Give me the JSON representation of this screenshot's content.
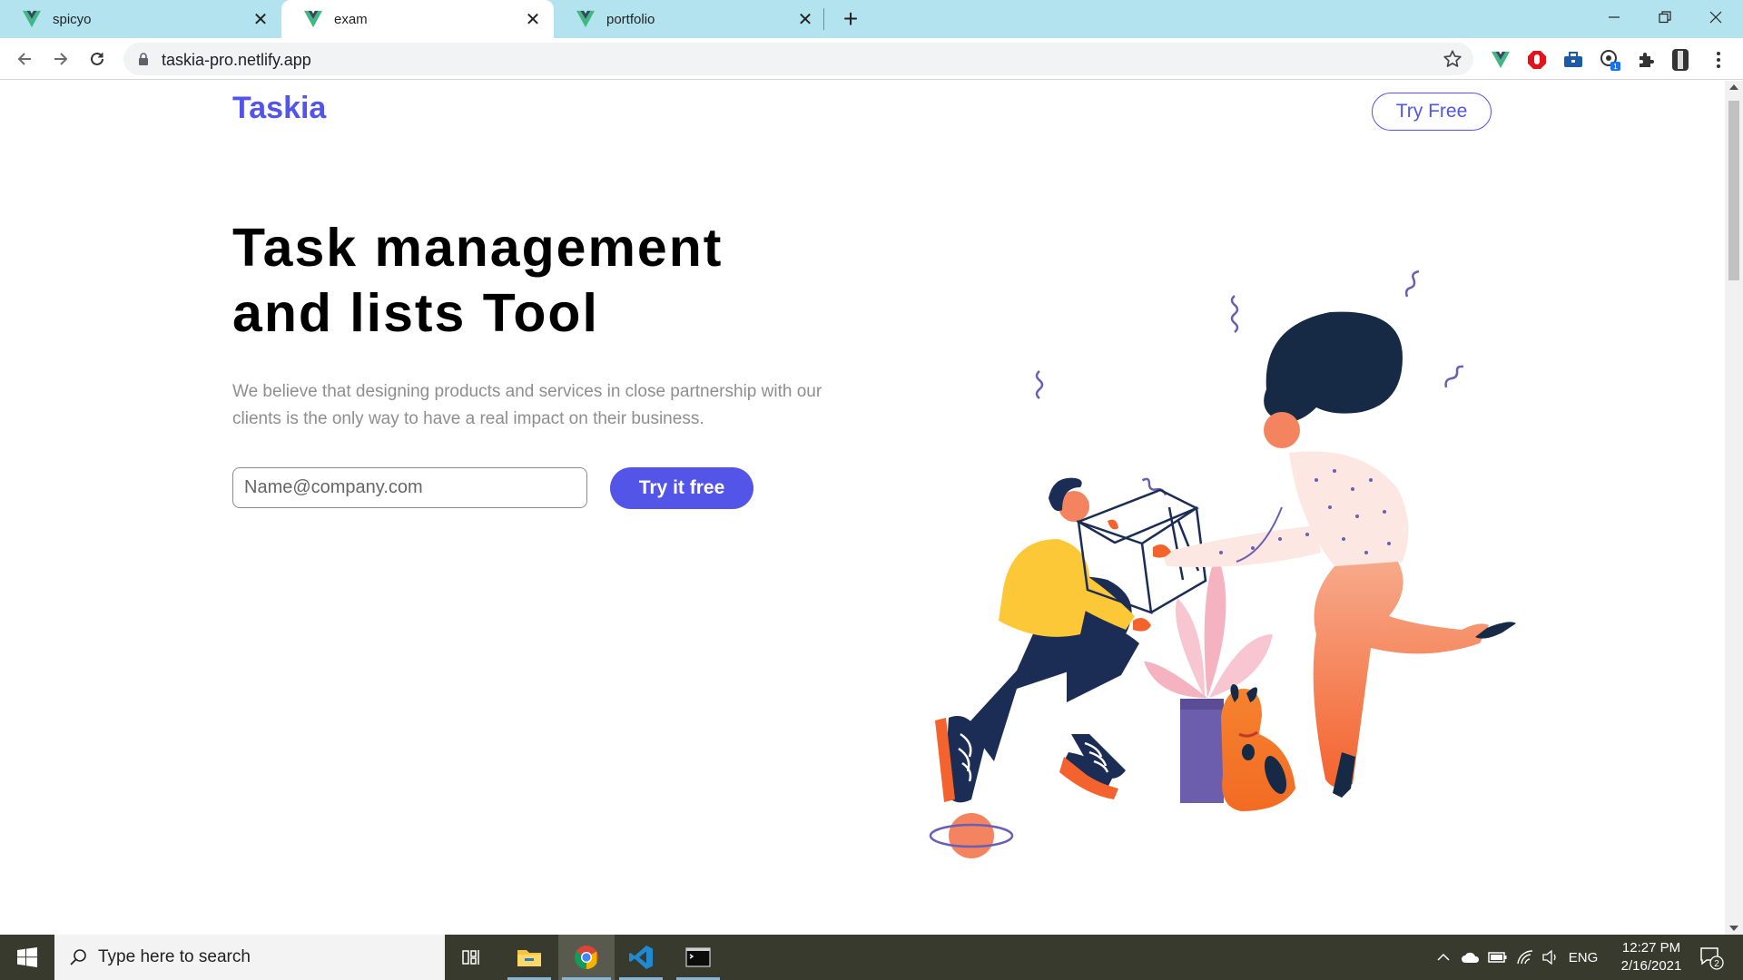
{
  "browser": {
    "tabs": [
      {
        "title": "spicyo",
        "active": false
      },
      {
        "title": "exam",
        "active": true
      },
      {
        "title": "portfolio",
        "active": false
      }
    ],
    "new_tab_symbol": "+",
    "url": "taskia-pro.netlify.app"
  },
  "site": {
    "logo": "Taskia",
    "nav_button": "Try Free",
    "hero": {
      "title_line1": "Task management",
      "title_line2": "and lists Tool",
      "subtitle": "We believe that designing products and services in close partnership with our clients is the only way to have a real impact on their business.",
      "email_placeholder": "Name@company.com",
      "cta_label": "Try it free"
    },
    "colors": {
      "brand": "#5355e8",
      "text": "#000000",
      "muted": "#8e8e8e"
    }
  },
  "taskbar": {
    "search_placeholder": "Type here to search",
    "language": "ENG",
    "time": "12:27 PM",
    "date": "2/16/2021",
    "notification_count": "2",
    "apps": [
      "task-view",
      "file-explorer",
      "chrome",
      "vscode",
      "terminal"
    ]
  },
  "extensions": {
    "badge_count": "1"
  }
}
